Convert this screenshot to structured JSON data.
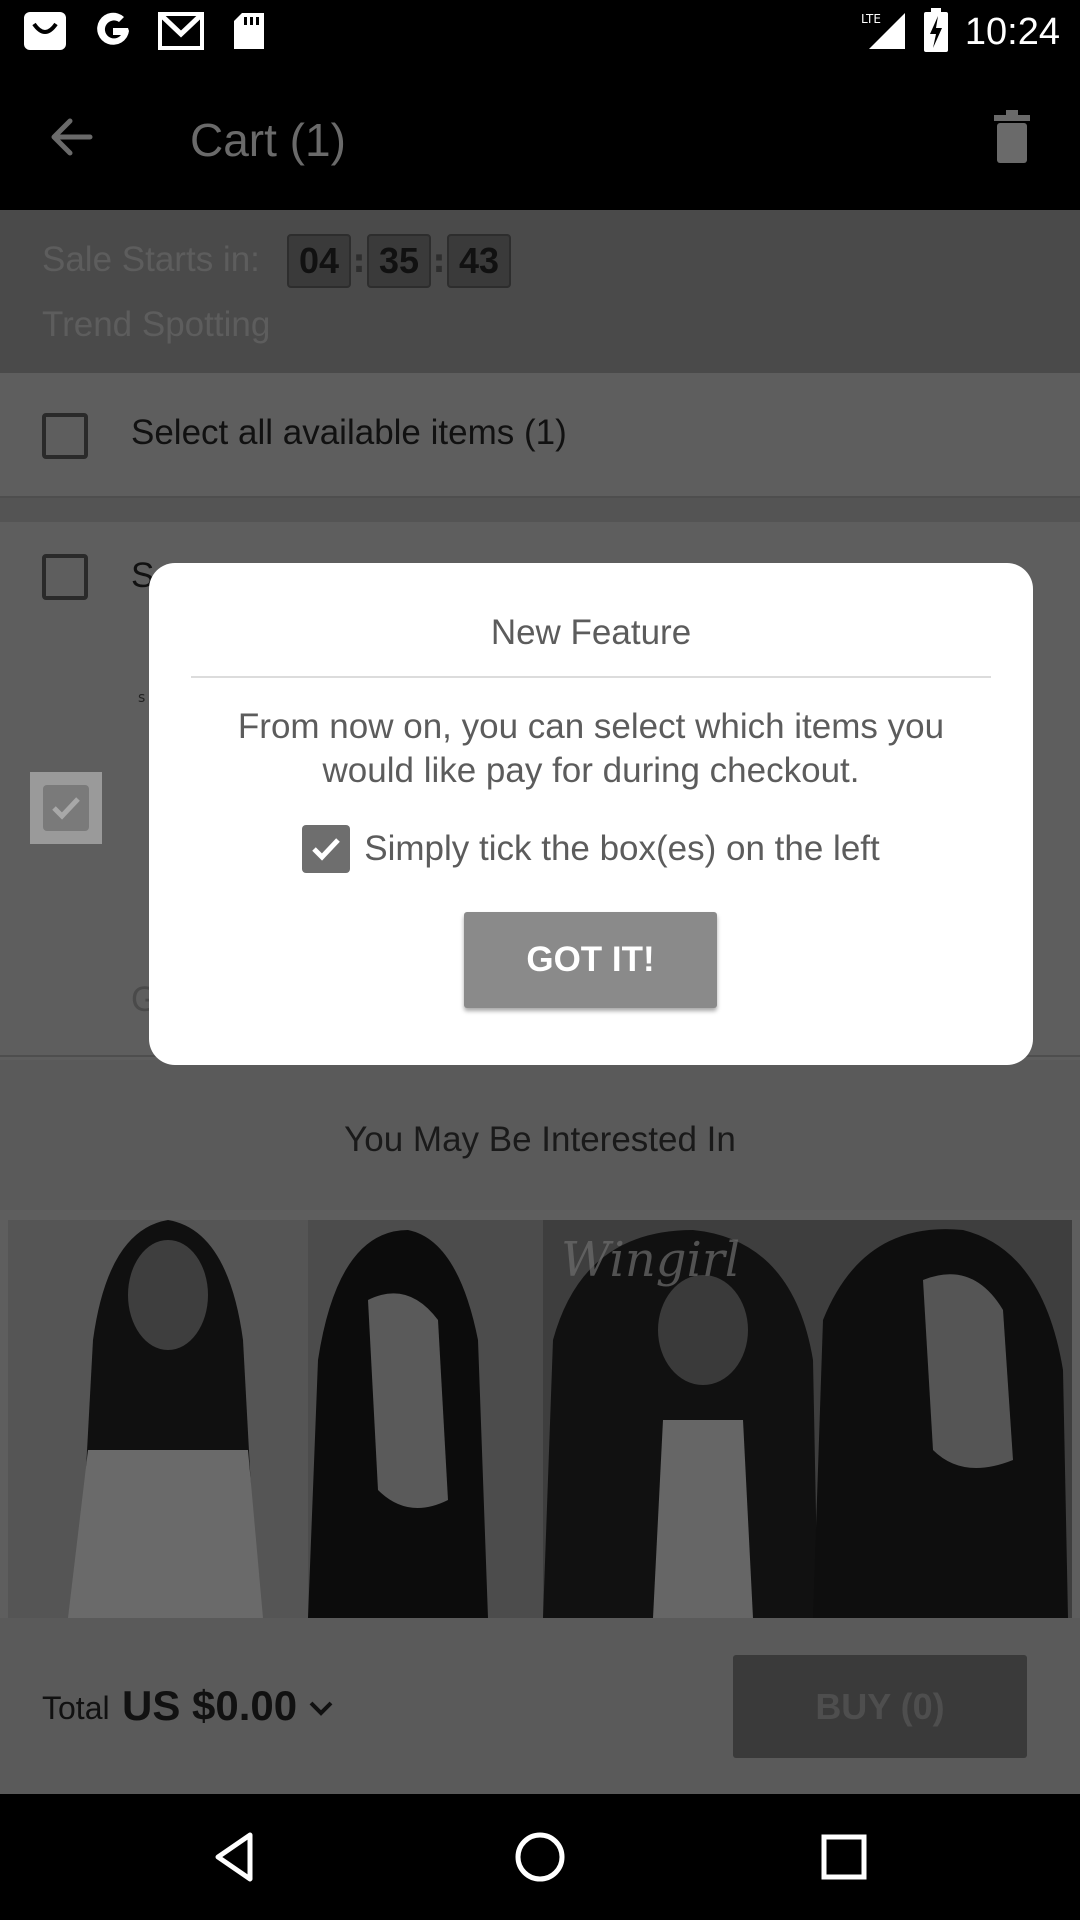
{
  "status_bar": {
    "time": "10:24",
    "network": "LTE",
    "left_icons": [
      "shopping-bag-icon",
      "google-icon",
      "gmail-icon",
      "sd-card-icon"
    ]
  },
  "app_bar": {
    "title": "Cart (1)"
  },
  "sale_banner": {
    "label": "Sale Starts in:",
    "countdown": [
      "04",
      "35",
      "43"
    ],
    "subtitle": "Trend Spotting"
  },
  "cart": {
    "select_all_label": "Select all available items (1)",
    "store_name_partial": "S",
    "item_partial_text": "G"
  },
  "recommendations": {
    "title": "You May Be Interested In",
    "watermark": "Wingirl"
  },
  "bottom_bar": {
    "total_label": "Total",
    "total_value": "US $0.00",
    "buy_label": "BUY (0)"
  },
  "dialog": {
    "title": "New Feature",
    "body": "From now on, you can select which items you would like pay for during checkout.",
    "hint": "Simply tick the box(es) on the left",
    "button_label": "GOT IT!"
  },
  "colors": {
    "overlay_dim": "#5e5e5e",
    "dialog_bg": "#ffffff",
    "button_bg": "#8a8a8a"
  }
}
